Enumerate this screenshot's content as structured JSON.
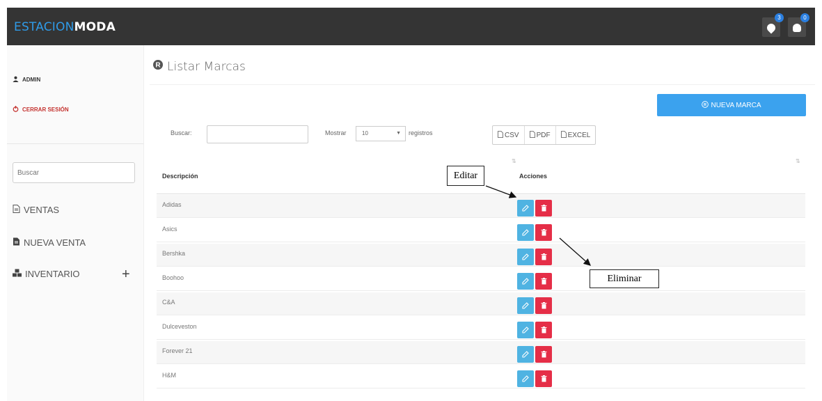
{
  "header": {
    "brand_part1": "ESTACION",
    "brand_part2": "MODA",
    "notifications": [
      {
        "icon": "paint-drop-icon",
        "badge": "3"
      },
      {
        "icon": "bell-icon",
        "badge": "0"
      }
    ]
  },
  "sidebar": {
    "user": "ADMIN",
    "logout": "CERRAR SESIÓN",
    "search_placeholder": "Buscar",
    "menu": [
      {
        "label": "VENTAS",
        "icon": "document-icon"
      },
      {
        "label": "NUEVA VENTA",
        "icon": "receipt-icon"
      },
      {
        "label": "INVENTARIO",
        "icon": "boxes-icon"
      }
    ]
  },
  "main": {
    "title": "Listar Marcas",
    "new_button": "NUEVA MARCA",
    "search_label": "Buscar:",
    "show_label": "Mostrar",
    "show_value": "10",
    "records_label": "registros",
    "export": [
      "CSV",
      "PDF",
      "EXCEL"
    ],
    "columns": [
      "Descripción",
      "Acciones"
    ],
    "rows": [
      "Adidas",
      "Asics",
      "Bershka",
      "Boohoo",
      "C&A",
      "Dulceveston",
      "Forever 21",
      "H&M"
    ]
  },
  "annotations": {
    "edit_label": "Editar",
    "delete_label": "Eliminar"
  },
  "colors": {
    "topbar": "#343434",
    "brand_accent": "#2f9be8",
    "primary_button": "#3ba2ee",
    "edit_button": "#4fb3e2",
    "delete_button": "#e52e47"
  }
}
